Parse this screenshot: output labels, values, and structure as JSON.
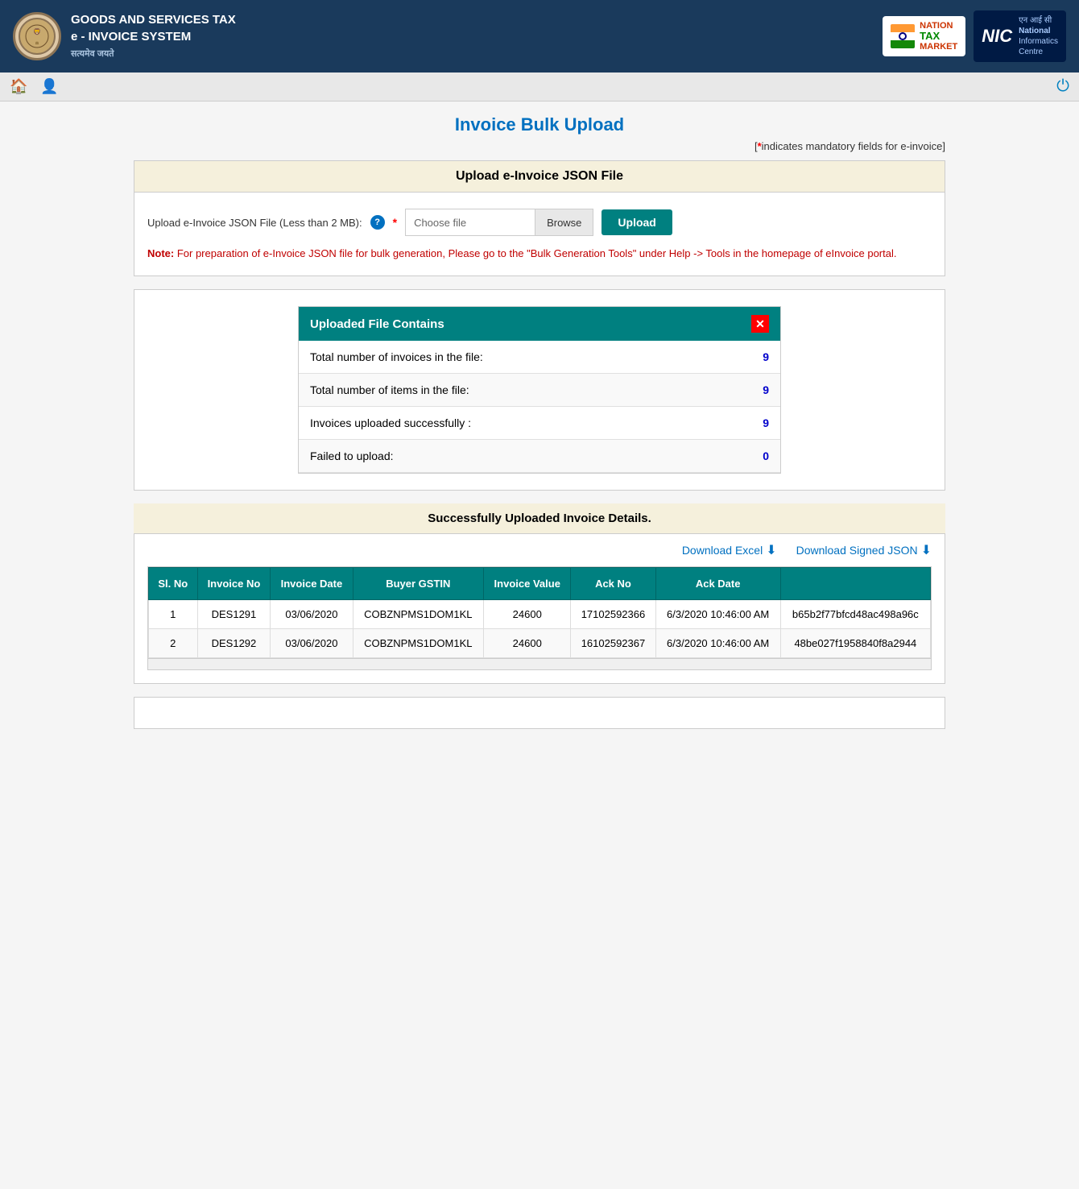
{
  "header": {
    "title_line1": "GOODS AND SERVICES TAX",
    "title_line2": "e - INVOICE SYSTEM",
    "satyamev": "सत्यमेव जयते"
  },
  "navbar": {
    "home_icon": "🏠",
    "user_icon": "👤",
    "power_icon": "⏻"
  },
  "page": {
    "title": "Invoice Bulk Upload",
    "mandatory_text": "[*indicates mandatory fields for e-invoice]"
  },
  "upload_section": {
    "header": "Upload e-Invoice JSON File",
    "label": "Upload e-Invoice JSON File (Less than 2 MB):",
    "file_placeholder": "Choose file",
    "browse_label": "Browse",
    "upload_label": "Upload",
    "note_label": "Note:",
    "note_text": "For preparation of e-Invoice JSON file for bulk generation, Please go to the \"Bulk Generation Tools\" under Help -> Tools in the homepage of eInvoice portal."
  },
  "results_section": {
    "header": "Uploaded File Contains",
    "rows": [
      {
        "label": "Total number of invoices in the file:",
        "value": "9"
      },
      {
        "label": "Total number of items in the file:",
        "value": "9"
      },
      {
        "label": "Invoices uploaded successfully :",
        "value": "9"
      },
      {
        "label": "Failed to upload:",
        "value": "0"
      }
    ]
  },
  "success_section": {
    "header": "Successfully Uploaded Invoice Details.",
    "download_excel": "Download Excel",
    "download_json": "Download Signed JSON"
  },
  "table": {
    "columns": [
      "Sl. No",
      "Invoice No",
      "Invoice Date",
      "Buyer GSTIN",
      "Invoice Value",
      "Ack No",
      "Ack Date",
      ""
    ],
    "rows": [
      {
        "sl": "1",
        "invoice_no": "DES1291",
        "invoice_date": "03/06/2020",
        "buyer_gstin": "COBZNPMS1DOM1KL",
        "invoice_value": "24600",
        "ack_no": "17102592366",
        "ack_date": "6/3/2020 10:46:00 AM",
        "irn": "b65b2f77bfcd48ac498a96c"
      },
      {
        "sl": "2",
        "invoice_no": "DES1292",
        "invoice_date": "03/06/2020",
        "buyer_gstin": "COBZNPMS1DOM1KL",
        "invoice_value": "24600",
        "ack_no": "16102592367",
        "ack_date": "6/3/2020 10:46:00 AM",
        "irn": "48be027f1958840f8a2944"
      }
    ]
  }
}
